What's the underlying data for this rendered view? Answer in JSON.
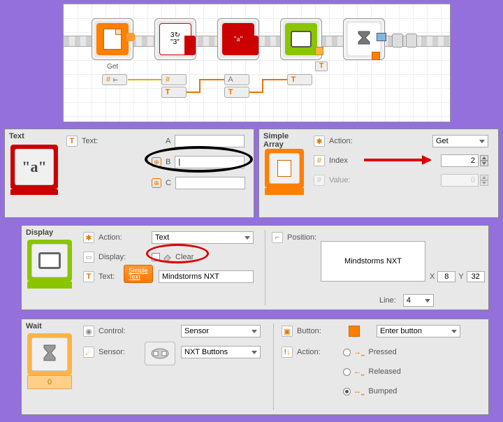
{
  "canvas": {
    "blocks": [
      {
        "name": "get-block",
        "color_left": "#ff7f00",
        "color_right": "#ff7f00",
        "glyph": "file",
        "label": "Get"
      },
      {
        "name": "num-to-text-block",
        "color_left": "#c00",
        "color_right": "#c00",
        "glyph": "3→\"3\""
      },
      {
        "name": "text-block",
        "color_left": "#c00",
        "color_right": "#c00",
        "glyph": "\"a\""
      },
      {
        "name": "display-block",
        "color_left": "#8bc500",
        "color_right": "#8bc500",
        "glyph": "screen"
      },
      {
        "name": "wait-block",
        "color_left": "#ff9a33",
        "color_right": "#ff9a33",
        "glyph": "hourglass"
      }
    ],
    "ports": {
      "hash": "#",
      "a": "A",
      "t": "T"
    }
  },
  "text_panel": {
    "title": "Text",
    "label": "Text:",
    "a_label": "A",
    "a_val": "",
    "b_label": "B",
    "b_val": "|",
    "c_label": "C",
    "c_val": ""
  },
  "array_panel": {
    "title": "Simple\nArray",
    "action_label": "Action:",
    "action_val": "Get",
    "index_label": "Index",
    "index_val": "2",
    "value_label": "Value:",
    "value_val": "0"
  },
  "display_panel": {
    "title": "Display",
    "action_label": "Action:",
    "action_val": "Text",
    "display_label": "Display:",
    "clear_label": "Clear",
    "text_label": "Text:",
    "simple_text_btn": "Simple\nText",
    "text_val": "Mindstorms NXT",
    "position_label": "Position:",
    "preview_text": "Mindstorms NXT",
    "x_label": "X",
    "x_val": "8",
    "y_label": "Y",
    "y_val": "32",
    "line_label": "Line:",
    "line_val": "4"
  },
  "wait_panel": {
    "title": "Wait",
    "counter": "0",
    "control_label": "Control:",
    "control_val": "Sensor",
    "sensor_label": "Sensor:",
    "sensor_val": "NXT Buttons",
    "button_label": "Button:",
    "button_val": "Enter button",
    "action_label": "Action:",
    "opt_pressed": "Pressed",
    "opt_released": "Released",
    "opt_bumped": "Bumped"
  }
}
